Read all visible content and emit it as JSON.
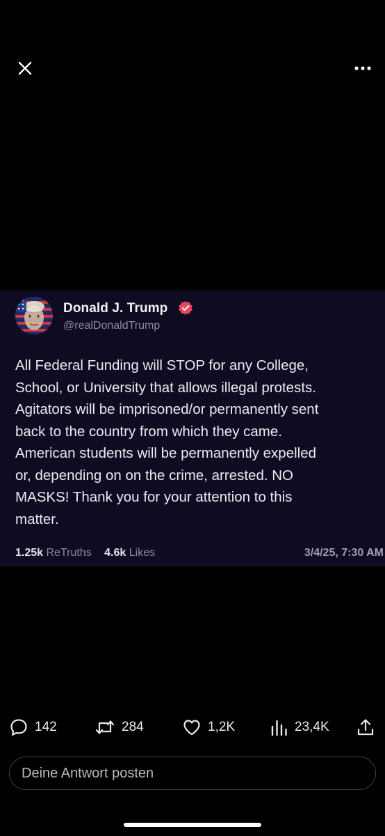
{
  "topbar": {
    "close_icon": "close-icon",
    "more_icon": "more-horizontal-icon"
  },
  "post_image": {
    "author": {
      "name": "Donald J. Trump",
      "handle": "@realDonaldTrump",
      "verified_icon": "verified-badge-icon",
      "verified_color": "#e8475b"
    },
    "text": "All Federal Funding will STOP for any College,\nSchool, or University that allows illegal protests.\nAgitators will be imprisoned/or permanently sent\nback to the country from which they came.\nAmerican students will be permanently expelled\nor, depending on on the crime, arrested. NO\nMASKS! Thank you for your attention to this\nmatter.",
    "stats": {
      "retruths_count": "1.25k",
      "retruths_label": "ReTruths",
      "likes_count": "4.6k",
      "likes_label": "Likes"
    },
    "date": "3/4/25, 7:30 AM",
    "background_color": "#0f0b22"
  },
  "actions": {
    "replies": "142",
    "reposts": "284",
    "likes": "1,2K",
    "views": "23,4K",
    "icons": [
      "reply-icon",
      "repost-icon",
      "like-icon",
      "views-icon",
      "share-icon"
    ]
  },
  "reply": {
    "placeholder": "Deine Antwort posten"
  }
}
